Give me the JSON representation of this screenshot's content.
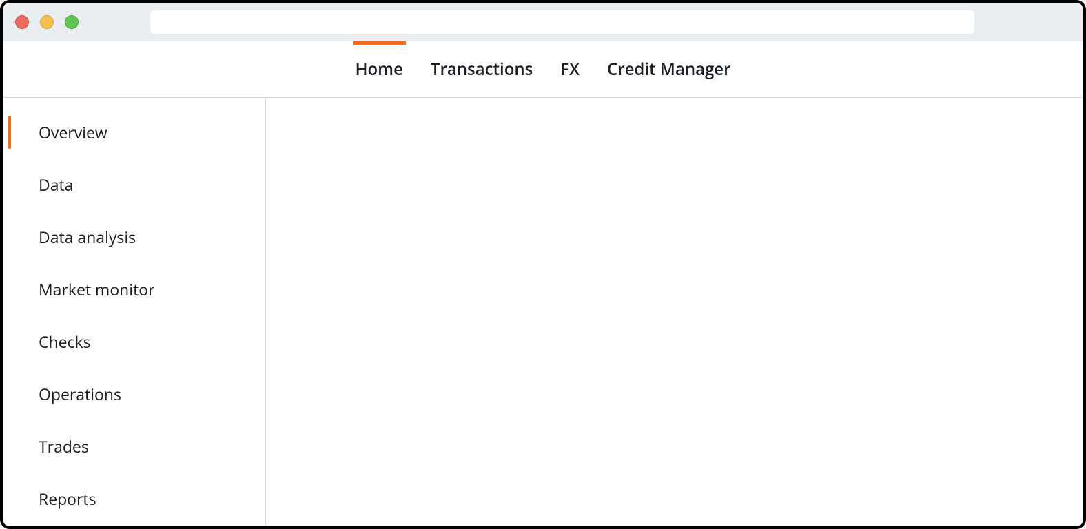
{
  "colors": {
    "accent": "#f36b1c"
  },
  "topnav": {
    "items": [
      {
        "label": "Home",
        "active": true
      },
      {
        "label": "Transactions",
        "active": false
      },
      {
        "label": "FX",
        "active": false
      },
      {
        "label": "Credit Manager",
        "active": false
      }
    ]
  },
  "sidebar": {
    "items": [
      {
        "label": "Overview",
        "active": true
      },
      {
        "label": "Data",
        "active": false
      },
      {
        "label": "Data analysis",
        "active": false
      },
      {
        "label": "Market monitor",
        "active": false
      },
      {
        "label": "Checks",
        "active": false
      },
      {
        "label": "Operations",
        "active": false
      },
      {
        "label": "Trades",
        "active": false
      },
      {
        "label": "Reports",
        "active": false
      }
    ]
  }
}
